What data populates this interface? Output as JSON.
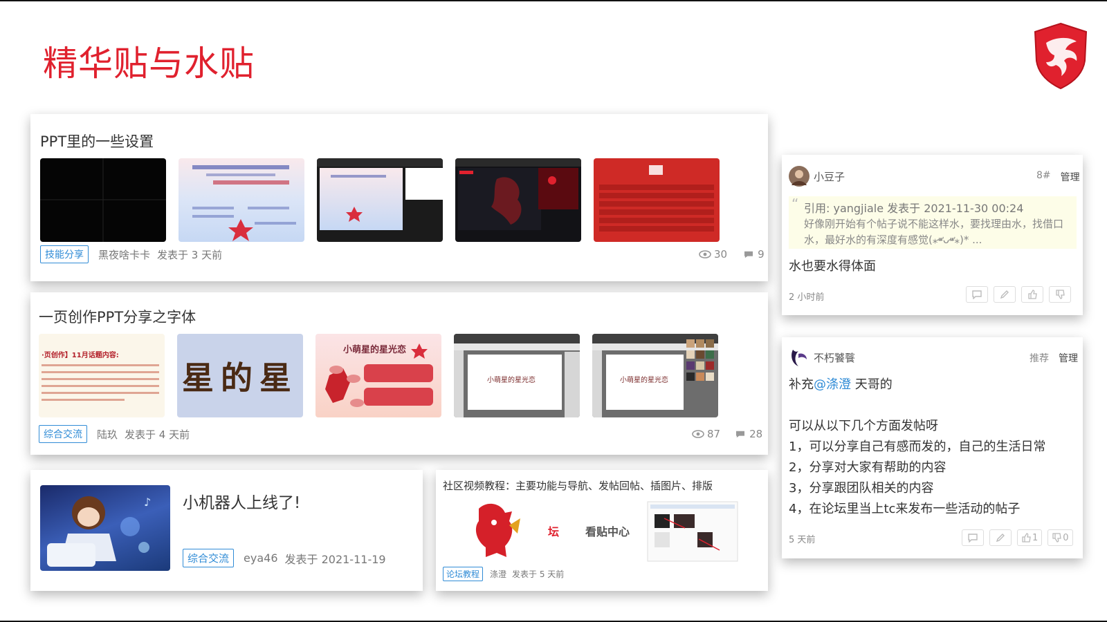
{
  "slide": {
    "title": "精华贴与水贴"
  },
  "post1": {
    "title": "PPT里的一些设置",
    "tag": "技能分享",
    "author": "黑夜啥卡卡",
    "time": "发表于 3 天前",
    "views": "30",
    "replies": "9"
  },
  "post2": {
    "title": "一页创作PPT分享之字体",
    "tag": "综合交流",
    "author": "陆玖",
    "time": "发表于 4 天前",
    "views": "87",
    "replies": "28",
    "thumb1_title": "·页创作】11月话题内容:",
    "thumb2_text": "星的星",
    "thumb3_text": "小萌星的星光恋",
    "thumb4_text": "小萌星的星光恋",
    "thumb5_text": "小萌星的星光恋"
  },
  "post3": {
    "title": "小机器人上线了!",
    "tag": "综合交流",
    "author": "eya46",
    "time": "发表于 2021-11-19"
  },
  "post4": {
    "title": "社区视频教程：主要功能与导航、发帖回帖、插图片、排版",
    "tag": "论坛教程",
    "author": "涤澄",
    "time": "发表于 5 天前",
    "img_text1": "坛",
    "img_text2": "看贴中心"
  },
  "comment1": {
    "user": "小豆子",
    "floor": "8#",
    "manage": "管理",
    "quote_head": "引用: yangjiale 发表于 2021-11-30 00:24",
    "quote_body": "好像刚开始有个帖子说不能这样水，要找理由水，找借口水，最好水的有深度有感觉(⁎⁍̴̛ᴗ⁍̴̛⁎)* ...",
    "body": "水也要水得体面",
    "time": "2 小时前"
  },
  "comment2": {
    "user": "不朽饕餮",
    "recommend": "推荐",
    "manage": "管理",
    "line1_prefix": "补充",
    "mention": "@涤澄",
    "line1_suffix": " 天哥的",
    "lines": [
      "可以从以下几个方面发帖呀",
      "1，可以分享自己有感而发的，自己的生活日常",
      "2，分享对大家有帮助的内容",
      "3，分享跟团队相关的内容",
      "4，在论坛里当上tc来发布一些活动的帖子"
    ],
    "time": "5 天前",
    "likes": "1",
    "dislikes": "0"
  },
  "colors": {
    "accent": "#e0212e",
    "tag": "#2f8bd6"
  }
}
